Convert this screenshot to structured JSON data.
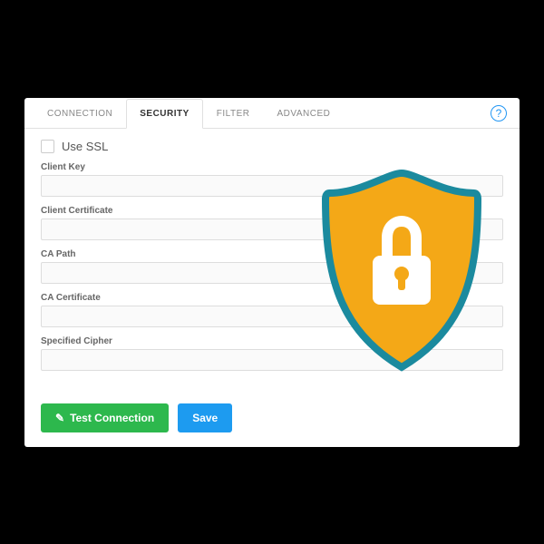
{
  "tabs": {
    "connection": "CONNECTION",
    "security": "SECURITY",
    "filter": "FILTER",
    "advanced": "ADVANCED"
  },
  "help_tooltip": "?",
  "ssl": {
    "label": "Use SSL",
    "checked": false
  },
  "fields": {
    "client_key": {
      "label": "Client Key",
      "value": ""
    },
    "client_certificate": {
      "label": "Client Certificate",
      "value": ""
    },
    "ca_path": {
      "label": "CA Path",
      "value": ""
    },
    "ca_certificate": {
      "label": "CA Certificate",
      "value": ""
    },
    "specified_cipher": {
      "label": "Specified Cipher",
      "value": ""
    }
  },
  "buttons": {
    "test_connection": "Test Connection",
    "save": "Save"
  },
  "colors": {
    "shield_fill": "#f4a817",
    "shield_stroke": "#1b8a9e",
    "lock_fill": "#ffffff"
  }
}
